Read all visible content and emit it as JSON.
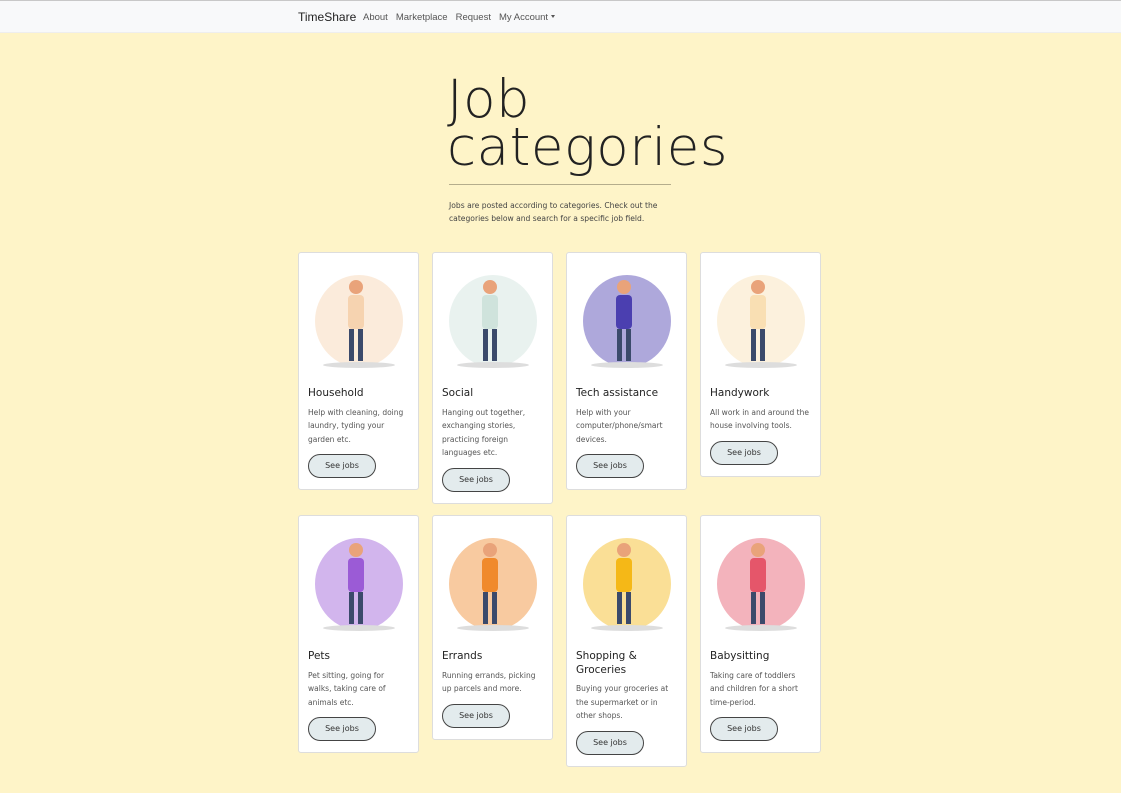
{
  "nav": {
    "brand": "TimeShare",
    "links": [
      "About",
      "Marketplace",
      "Request",
      "My Account"
    ]
  },
  "hero": {
    "title_line1": "Job",
    "title_line2": "categories",
    "intro": "Jobs are posted according to categories. Check out the categories below and search for a specific job field."
  },
  "button_label": "See jobs",
  "cards": [
    {
      "title": "Household",
      "desc": "Help with cleaning, doing laundry, tyding your garden etc.",
      "color": "#f6d3b0"
    },
    {
      "title": "Social",
      "desc": "Hanging out together, exchanging stories, practicing foreign languages etc.",
      "color": "#cfe3dc"
    },
    {
      "title": "Tech assistance",
      "desc": "Help with your computer/phone/smart devices.",
      "color": "#4b3fb0"
    },
    {
      "title": "Handywork",
      "desc": "All work in and around the house involving tools.",
      "color": "#f9dfb3"
    },
    {
      "title": "Pets",
      "desc": "Pet sitting, going for walks, taking care of animals etc.",
      "color": "#9b5bd6"
    },
    {
      "title": "Errands",
      "desc": "Running errands, picking up parcels and more.",
      "color": "#f08a2c"
    },
    {
      "title": "Shopping & Groceries",
      "desc": "Buying your groceries at the supermarket or in other shops.",
      "color": "#f5b817"
    },
    {
      "title": "Babysitting",
      "desc": "Taking care of toddlers and children for a short time-period.",
      "color": "#e5566a"
    }
  ]
}
